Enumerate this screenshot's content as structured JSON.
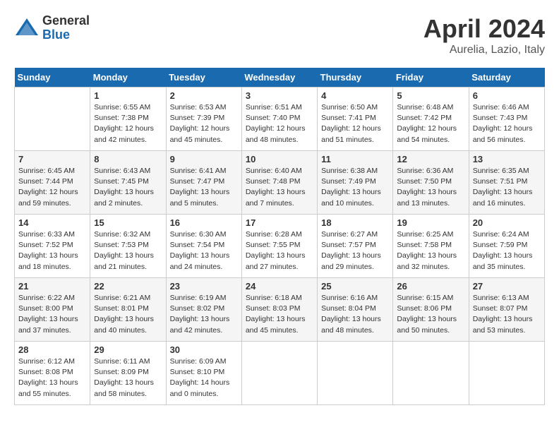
{
  "header": {
    "logo_general": "General",
    "logo_blue": "Blue",
    "month_title": "April 2024",
    "location": "Aurelia, Lazio, Italy"
  },
  "days_of_week": [
    "Sunday",
    "Monday",
    "Tuesday",
    "Wednesday",
    "Thursday",
    "Friday",
    "Saturday"
  ],
  "weeks": [
    [
      {
        "day": "",
        "info": ""
      },
      {
        "day": "1",
        "info": "Sunrise: 6:55 AM\nSunset: 7:38 PM\nDaylight: 12 hours\nand 42 minutes."
      },
      {
        "day": "2",
        "info": "Sunrise: 6:53 AM\nSunset: 7:39 PM\nDaylight: 12 hours\nand 45 minutes."
      },
      {
        "day": "3",
        "info": "Sunrise: 6:51 AM\nSunset: 7:40 PM\nDaylight: 12 hours\nand 48 minutes."
      },
      {
        "day": "4",
        "info": "Sunrise: 6:50 AM\nSunset: 7:41 PM\nDaylight: 12 hours\nand 51 minutes."
      },
      {
        "day": "5",
        "info": "Sunrise: 6:48 AM\nSunset: 7:42 PM\nDaylight: 12 hours\nand 54 minutes."
      },
      {
        "day": "6",
        "info": "Sunrise: 6:46 AM\nSunset: 7:43 PM\nDaylight: 12 hours\nand 56 minutes."
      }
    ],
    [
      {
        "day": "7",
        "info": "Sunrise: 6:45 AM\nSunset: 7:44 PM\nDaylight: 12 hours\nand 59 minutes."
      },
      {
        "day": "8",
        "info": "Sunrise: 6:43 AM\nSunset: 7:45 PM\nDaylight: 13 hours\nand 2 minutes."
      },
      {
        "day": "9",
        "info": "Sunrise: 6:41 AM\nSunset: 7:47 PM\nDaylight: 13 hours\nand 5 minutes."
      },
      {
        "day": "10",
        "info": "Sunrise: 6:40 AM\nSunset: 7:48 PM\nDaylight: 13 hours\nand 7 minutes."
      },
      {
        "day": "11",
        "info": "Sunrise: 6:38 AM\nSunset: 7:49 PM\nDaylight: 13 hours\nand 10 minutes."
      },
      {
        "day": "12",
        "info": "Sunrise: 6:36 AM\nSunset: 7:50 PM\nDaylight: 13 hours\nand 13 minutes."
      },
      {
        "day": "13",
        "info": "Sunrise: 6:35 AM\nSunset: 7:51 PM\nDaylight: 13 hours\nand 16 minutes."
      }
    ],
    [
      {
        "day": "14",
        "info": "Sunrise: 6:33 AM\nSunset: 7:52 PM\nDaylight: 13 hours\nand 18 minutes."
      },
      {
        "day": "15",
        "info": "Sunrise: 6:32 AM\nSunset: 7:53 PM\nDaylight: 13 hours\nand 21 minutes."
      },
      {
        "day": "16",
        "info": "Sunrise: 6:30 AM\nSunset: 7:54 PM\nDaylight: 13 hours\nand 24 minutes."
      },
      {
        "day": "17",
        "info": "Sunrise: 6:28 AM\nSunset: 7:55 PM\nDaylight: 13 hours\nand 27 minutes."
      },
      {
        "day": "18",
        "info": "Sunrise: 6:27 AM\nSunset: 7:57 PM\nDaylight: 13 hours\nand 29 minutes."
      },
      {
        "day": "19",
        "info": "Sunrise: 6:25 AM\nSunset: 7:58 PM\nDaylight: 13 hours\nand 32 minutes."
      },
      {
        "day": "20",
        "info": "Sunrise: 6:24 AM\nSunset: 7:59 PM\nDaylight: 13 hours\nand 35 minutes."
      }
    ],
    [
      {
        "day": "21",
        "info": "Sunrise: 6:22 AM\nSunset: 8:00 PM\nDaylight: 13 hours\nand 37 minutes."
      },
      {
        "day": "22",
        "info": "Sunrise: 6:21 AM\nSunset: 8:01 PM\nDaylight: 13 hours\nand 40 minutes."
      },
      {
        "day": "23",
        "info": "Sunrise: 6:19 AM\nSunset: 8:02 PM\nDaylight: 13 hours\nand 42 minutes."
      },
      {
        "day": "24",
        "info": "Sunrise: 6:18 AM\nSunset: 8:03 PM\nDaylight: 13 hours\nand 45 minutes."
      },
      {
        "day": "25",
        "info": "Sunrise: 6:16 AM\nSunset: 8:04 PM\nDaylight: 13 hours\nand 48 minutes."
      },
      {
        "day": "26",
        "info": "Sunrise: 6:15 AM\nSunset: 8:06 PM\nDaylight: 13 hours\nand 50 minutes."
      },
      {
        "day": "27",
        "info": "Sunrise: 6:13 AM\nSunset: 8:07 PM\nDaylight: 13 hours\nand 53 minutes."
      }
    ],
    [
      {
        "day": "28",
        "info": "Sunrise: 6:12 AM\nSunset: 8:08 PM\nDaylight: 13 hours\nand 55 minutes."
      },
      {
        "day": "29",
        "info": "Sunrise: 6:11 AM\nSunset: 8:09 PM\nDaylight: 13 hours\nand 58 minutes."
      },
      {
        "day": "30",
        "info": "Sunrise: 6:09 AM\nSunset: 8:10 PM\nDaylight: 14 hours\nand 0 minutes."
      },
      {
        "day": "",
        "info": ""
      },
      {
        "day": "",
        "info": ""
      },
      {
        "day": "",
        "info": ""
      },
      {
        "day": "",
        "info": ""
      }
    ]
  ]
}
